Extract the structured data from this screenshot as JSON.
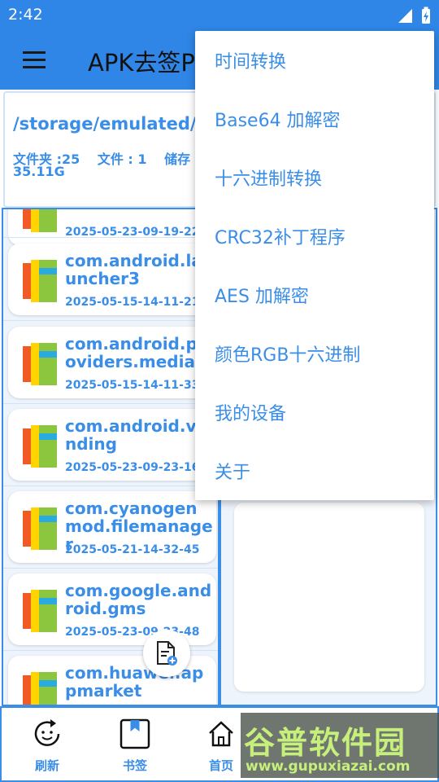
{
  "status_bar": {
    "time": "2:42"
  },
  "app_bar": {
    "title": "APK去签P"
  },
  "path_panel": {
    "path": "/storage/emulated/0/",
    "folder_count": "文件夹 :25",
    "file_count": "文件 : 1",
    "storage_label": "储存",
    "storage_value": "35.11G"
  },
  "file_list": {
    "partial_item": {
      "date": "2025-05-23-09-19-22"
    },
    "items": [
      {
        "name": "com.android.launcher3",
        "date": "2025-05-15-14-11-21"
      },
      {
        "name": "com.android.providers.media",
        "date": "2025-05-15-14-11-33"
      },
      {
        "name": "com.android.vending",
        "date": "2025-05-23-09-23-16"
      },
      {
        "name": "com.cyanogenmod.filemanager",
        "date": "2025-05-21-14-32-45"
      },
      {
        "name": "com.google.android.gms",
        "date": "2025-05-23-09-23-48"
      },
      {
        "name": "com.huawei.appmarket",
        "date": ""
      }
    ]
  },
  "bottom_nav": {
    "items": [
      {
        "label": "刷新",
        "icon": "refresh-icon"
      },
      {
        "label": "书签",
        "icon": "bookmark-icon"
      },
      {
        "label": "首页",
        "icon": "home-icon"
      }
    ]
  },
  "menu": {
    "items": [
      {
        "label": "时间转换"
      },
      {
        "label": "Base64 加解密"
      },
      {
        "label": "十六进制转换"
      },
      {
        "label": "CRC32补丁程序"
      },
      {
        "label": "AES 加解密"
      },
      {
        "label": "颜色RGB十六进制"
      },
      {
        "label": "我的设备"
      },
      {
        "label": "关于"
      }
    ]
  },
  "watermark": {
    "text": "谷普软件园",
    "url": "www.gupuxiazai.com"
  },
  "colors": {
    "primary": "#2f86e6",
    "accent_text": "#3a8ee8",
    "list_bg": "#eef4fb"
  }
}
